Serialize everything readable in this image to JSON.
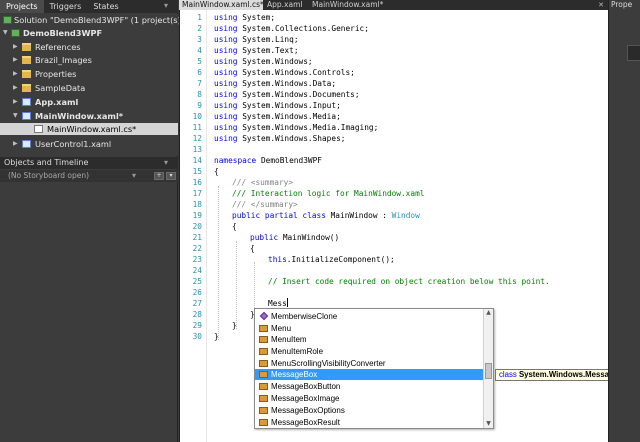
{
  "left_panel": {
    "tabs": [
      "Projects",
      "Triggers",
      "States"
    ],
    "solution_label": "Solution \"DemoBlend3WPF\" (1 project(s))",
    "tree": [
      {
        "label": "DemoBlend3WPF",
        "icon": "project-icon"
      },
      {
        "label": "References",
        "icon": "folder-icon"
      },
      {
        "label": "Brazil_Images",
        "icon": "folder-icon"
      },
      {
        "label": "Properties",
        "icon": "folder-icon"
      },
      {
        "label": "SampleData",
        "icon": "folder-icon"
      },
      {
        "label": "App.xaml",
        "icon": "xaml-file-icon"
      },
      {
        "label": "MainWindow.xaml*",
        "icon": "xaml-file-icon"
      },
      {
        "label": "MainWindow.xaml.cs*",
        "icon": "cs-file-icon"
      },
      {
        "label": "UserControl1.xaml",
        "icon": "xaml-file-icon"
      }
    ],
    "objects_timeline": {
      "title": "Objects and Timeline",
      "storyboard": "(No Storyboard open)"
    }
  },
  "editor": {
    "tabs": [
      "MainWindow.xaml.cs*",
      "App.xaml",
      "MainWindow.xaml*"
    ],
    "active_tab": "MainWindow.xaml.cs*",
    "line_numbers": [
      "1",
      "2",
      "3",
      "4",
      "5",
      "6",
      "7",
      "8",
      "9",
      "10",
      "11",
      "12",
      "13",
      "14",
      "15",
      "16",
      "17",
      "18",
      "19",
      "20",
      "21",
      "22",
      "23",
      "24",
      "25",
      "26",
      "27",
      "28",
      "29",
      "30"
    ],
    "lines": {
      "l1": "System;",
      "l2": "System.Collections.Generic;",
      "l3": "System.Linq;",
      "l4": "System.Text;",
      "l5": "System.Windows;",
      "l6": "System.Windows.Controls;",
      "l7": "System.Windows.Data;",
      "l8": "System.Windows.Documents;",
      "l9": "System.Windows.Input;",
      "l10": "System.Windows.Media;",
      "l11": "System.Windows.Media.Imaging;",
      "l12": "System.Windows.Shapes;",
      "kw_using": "using",
      "kw_namespace": "namespace",
      "namespace_name": " DemoBlend3WPF",
      "open_brace": "{",
      "close_brace": "}",
      "xml_slashes": "///",
      "summary_open": " <summary>",
      "summary_text": "/// Interaction logic for MainWindow.xaml",
      "summary_close": " </summary>",
      "kw_public": "public",
      "kw_partial": "partial",
      "kw_class": "class",
      "class_decl": " MainWindow : ",
      "base_type": "Window",
      "ctor": " MainWindow()",
      "kw_this": "this",
      "init_call": ".InitializeComponent();",
      "comment_insert": "// Insert code required on object creation below this point.",
      "typed": "Mess"
    }
  },
  "completion": {
    "items": [
      "MemberwiseClone",
      "Menu",
      "MenuItem",
      "MenuItemRole",
      "MenuScrollingVisibilityConverter",
      "MessageBox",
      "MessageBoxButton",
      "MessageBoxImage",
      "MessageBoxOptions",
      "MessageBoxResult"
    ],
    "selected": "MessageBox",
    "tooltip_kw": "class",
    "tooltip_type": "System.Windows.MessageBox"
  },
  "right_panel": {
    "title": "Prope"
  },
  "colors": {
    "keyword": "#0000ff",
    "comment": "#008000",
    "type": "#2b91af",
    "selection": "#3399ff"
  }
}
